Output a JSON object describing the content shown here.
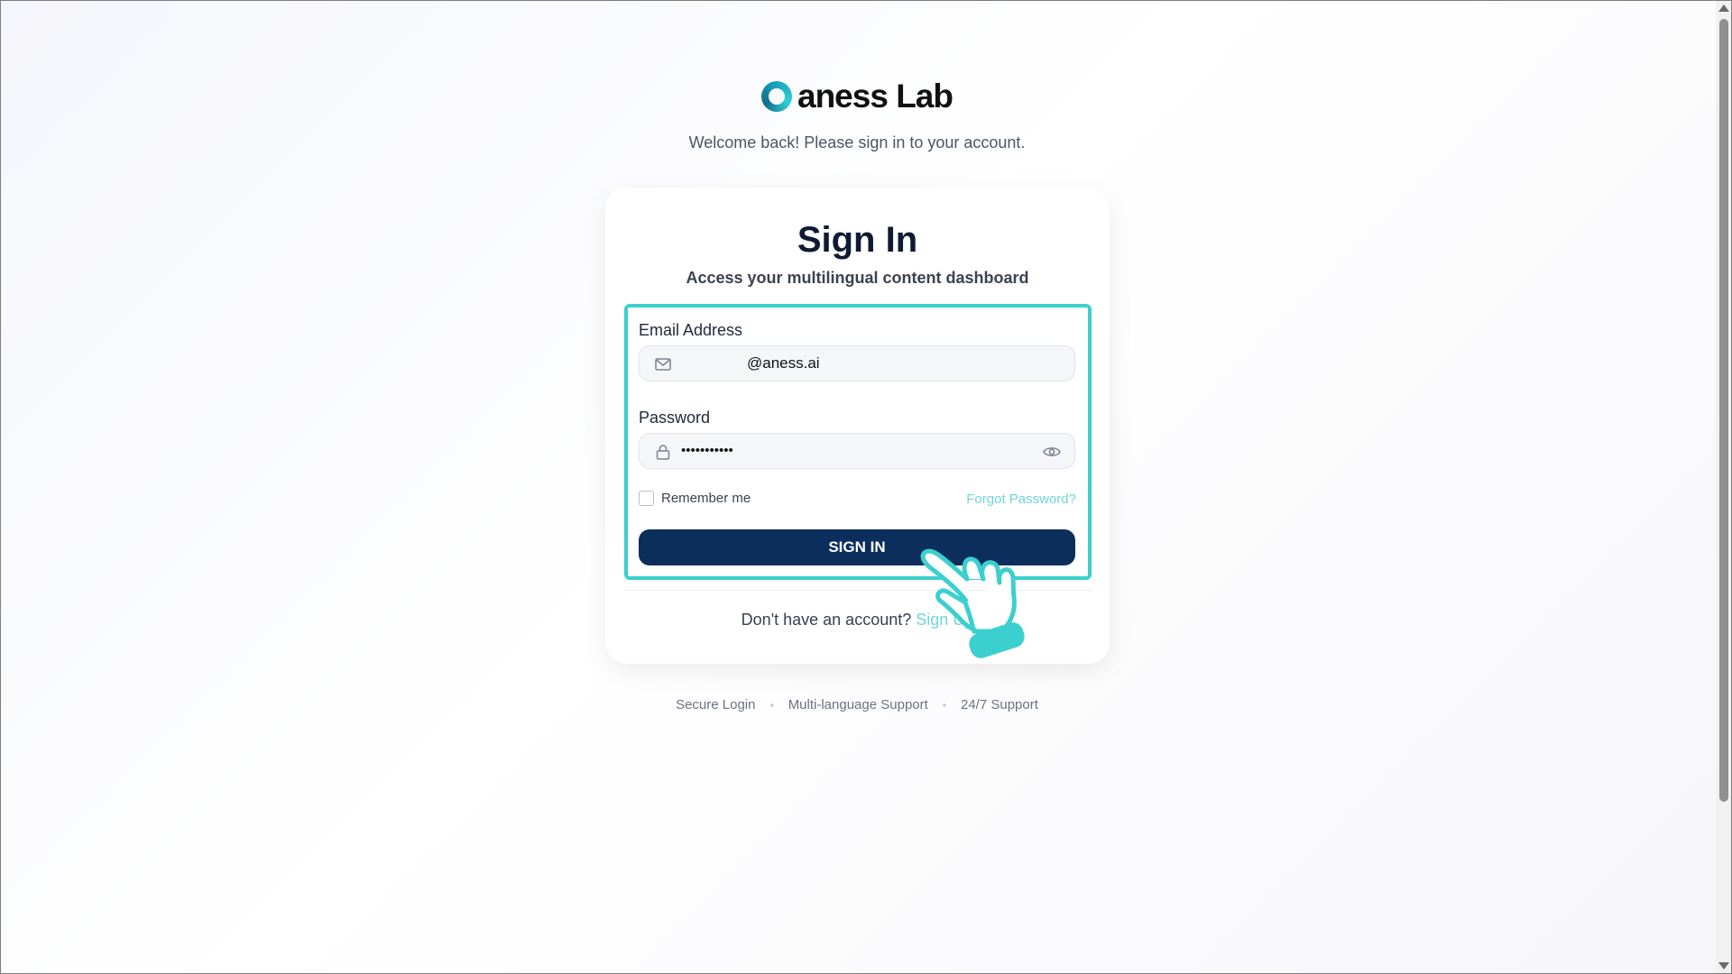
{
  "brand": {
    "name": "aness Lab",
    "welcome": "Welcome back! Please sign in to your account."
  },
  "card": {
    "title": "Sign In",
    "subtitle": "Access your multilingual content dashboard"
  },
  "form": {
    "email_label": "Email Address",
    "email_value": "@aness.ai",
    "password_label": "Password",
    "password_value": "•••••••••••",
    "remember_label": "Remember me",
    "remember_checked": false,
    "forgot_label": "Forgot Password?",
    "submit_label": "SIGN IN"
  },
  "signup": {
    "prompt": "Don't have an account?",
    "link_label": "Sign Up"
  },
  "footer": {
    "items": [
      "Secure Login",
      "Multi-language Support",
      "24/7 Support"
    ]
  },
  "colors": {
    "primary": "#0b2e5c",
    "accent": "#3ccfcf",
    "link": "#6fd6d6"
  },
  "icons": {
    "email": "mail-icon",
    "password": "lock-icon",
    "toggle_password": "eye-icon",
    "pointer": "hand-pointer-icon"
  }
}
